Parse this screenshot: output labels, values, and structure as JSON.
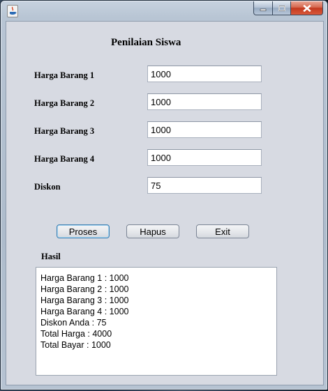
{
  "window": {
    "icon": "java-icon",
    "buttons": {
      "minimize": "minimize-icon",
      "maximize": "maximize-icon",
      "close": "close-icon"
    }
  },
  "form": {
    "title": "Penilaian Siswa",
    "fields": [
      {
        "label": "Harga Barang 1",
        "value": "1000"
      },
      {
        "label": "Harga Barang 2",
        "value": "1000"
      },
      {
        "label": "Harga Barang 3",
        "value": "1000"
      },
      {
        "label": "Harga Barang 4",
        "value": "1000"
      },
      {
        "label": "Diskon",
        "value": "75"
      }
    ],
    "buttons": {
      "proses": "Proses",
      "hapus": "Hapus",
      "exit": "Exit"
    },
    "result_label": "Hasil",
    "result_lines": [
      "Harga Barang 1 : 1000",
      "Harga Barang 2 : 1000",
      "Harga Barang 3 : 1000",
      "Harga Barang 4 : 1000",
      "Diskon Anda : 75",
      "Total Harga : 4000",
      "Total Bayar : 1000"
    ]
  },
  "colors": {
    "client_bg": "#d7dae2",
    "close_button": "#c23a1f",
    "default_button_border": "#3c7fb1"
  }
}
